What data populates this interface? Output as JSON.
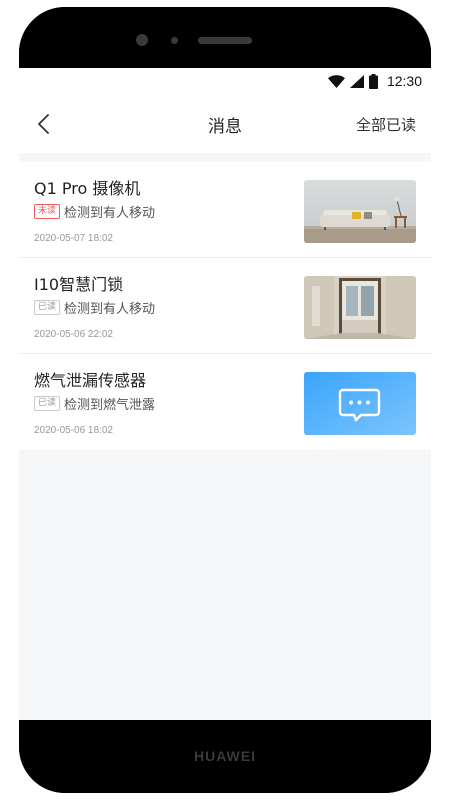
{
  "status_bar": {
    "time": "12:30",
    "icons": [
      "wifi-icon",
      "signal-icon",
      "battery-icon"
    ]
  },
  "nav": {
    "title": "消息",
    "mark_all_read": "全部已读",
    "back_icon": "chevron-left-icon"
  },
  "messages": [
    {
      "title": "Q1 Pro 摄像机",
      "badge": "未读",
      "unread": true,
      "description": "检测到有人移动",
      "time": "2020-05-07 18:02",
      "thumbnail": "living-room-photo"
    },
    {
      "title": "I10智慧门锁",
      "badge": "已读",
      "unread": false,
      "description": "检测到有人移动",
      "time": "2020-05-06 22:02",
      "thumbnail": "hallway-photo"
    },
    {
      "title": "燃气泄漏传感器",
      "badge": "已读",
      "unread": false,
      "description": "检测到燃气泄露",
      "time": "2020-05-06 18:02",
      "thumbnail": "message-bubble-icon"
    }
  ],
  "device": {
    "brand": "HUAWEI"
  },
  "colors": {
    "unread_badge": "#f25b5b",
    "read_badge_border": "#c9c9c9",
    "screen_background": "#f5f6f8",
    "gas_tile_gradient_start": "#3aa5fb",
    "gas_tile_gradient_end": "#7cc4fd"
  }
}
